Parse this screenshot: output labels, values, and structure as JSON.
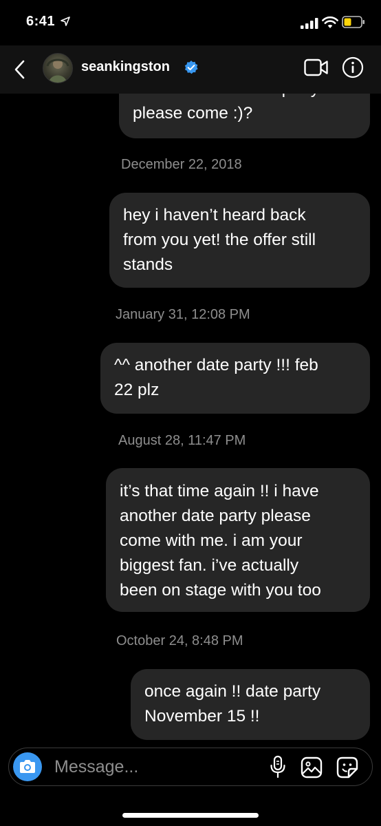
{
  "status_bar": {
    "time": "6:41"
  },
  "header": {
    "username": "seankingston",
    "verified": true
  },
  "messages": [
    {
      "text": "i have another date party\nplease come :)?"
    },
    {
      "text": "hey i haven’t heard back\nfrom you yet! the offer still\nstands"
    },
    {
      "text": "^^ another date party !!! feb\n22 plz"
    },
    {
      "text": "it’s that time again !! i have\nanother date party please\ncome with me. i am your\nbiggest fan. i’ve actually\nbeen on stage with you too"
    },
    {
      "text": "once again !! date party\nNovember 15 !!"
    }
  ],
  "timestamps": [
    "December 22, 2018",
    "January 31, 12:08 PM",
    "August 28, 11:47 PM",
    "October 24, 8:48 PM"
  ],
  "composer": {
    "placeholder": "Message..."
  },
  "colors": {
    "bubble": "#262626",
    "accent_blue": "#3a97f0",
    "verified_blue": "#3897f0",
    "battery_low": "#ffd60a"
  }
}
